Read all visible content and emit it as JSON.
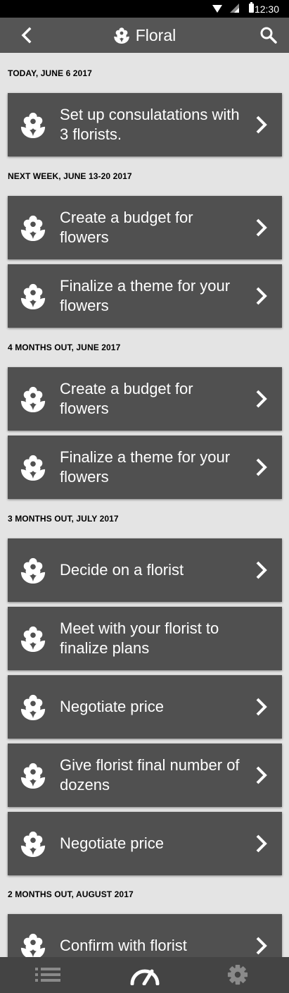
{
  "status": {
    "time": "12:30"
  },
  "appbar": {
    "title": "Floral",
    "back_icon": "chevron-left-icon",
    "search_icon": "search-icon"
  },
  "sections": [
    {
      "header": "TODAY, JUNE 6 2017",
      "tasks": [
        "Set up consulatations with 3 florists."
      ]
    },
    {
      "header": "NEXT WEEK, JUNE 13-20 2017",
      "tasks": [
        "Create a budget for flowers",
        "Finalize a theme for your flowers"
      ]
    },
    {
      "header": "4 MONTHS OUT, JUNE 2017",
      "tasks": [
        "Create a budget for flowers",
        "Finalize a theme for your flowers"
      ]
    },
    {
      "header": "3 MONTHS OUT, JULY 2017",
      "tasks": [
        "Decide on a florist",
        "Meet with your florist to finalize plans",
        "Negotiate price",
        "Give florist final number of dozens",
        "Negotiate price"
      ]
    },
    {
      "header": "2 MONTHS OUT, AUGUST 2017",
      "tasks": [
        "Confirm with florist"
      ]
    }
  ],
  "bottom_nav": [
    {
      "icon": "list-icon",
      "active": false
    },
    {
      "icon": "speedometer-icon",
      "active": true
    },
    {
      "icon": "gear-icon",
      "active": false
    }
  ],
  "colors": {
    "appbar": "#555555",
    "card": "#505050",
    "background": "#e4e4e4",
    "bottombar": "#444444",
    "icon_inactive": "#888888",
    "icon_active": "#ffffff"
  }
}
